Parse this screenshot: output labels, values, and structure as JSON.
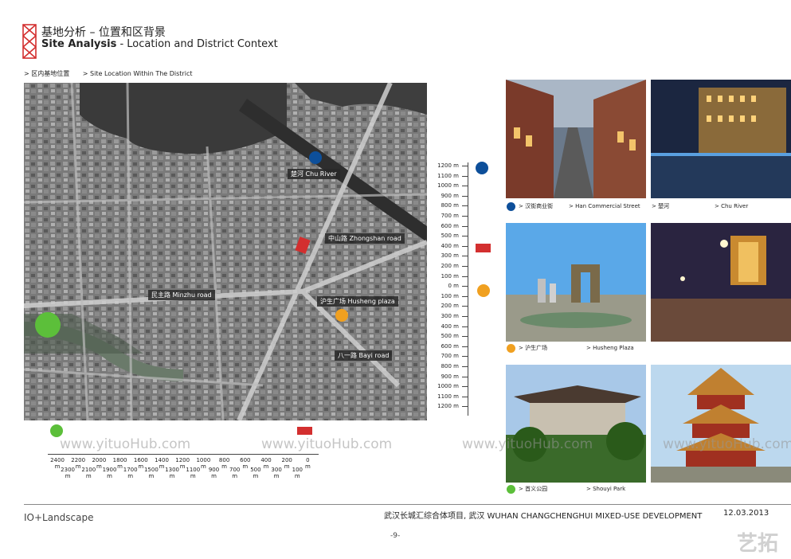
{
  "header": {
    "title_cn": "基地分析 – 位置和区背景",
    "title_en_bold": "Site Analysis",
    "title_en_rest": " - Location and District Context"
  },
  "subhead": {
    "cn": "> 区内基地位置",
    "en": "> Site Location Within The District"
  },
  "map": {
    "labels": {
      "chu_river": "楚河  Chu River",
      "zhongshan": "中山路  Zhongshan road",
      "minzhu": "民主路  Minzhu road",
      "husheng": "沪生广场  Husheng plaza",
      "bayi": "八一路  Bayi road"
    }
  },
  "scale_vertical": {
    "labels": [
      "1200 m",
      "1100 m",
      "1000 m",
      "900 m",
      "800 m",
      "700 m",
      "600 m",
      "500 m",
      "400 m",
      "300 m",
      "200 m",
      "100 m",
      "0 m",
      "100 m",
      "200 m",
      "300 m",
      "400 m",
      "500 m",
      "600 m",
      "700 m",
      "800 m",
      "900 m",
      "1000 m",
      "1100 m",
      "1200 m"
    ]
  },
  "scale_horizontal": {
    "labels": [
      "2400 m",
      "2300 m",
      "2200 m",
      "2100 m",
      "2000 m",
      "1900 m",
      "1800 m",
      "1700 m",
      "1600 m",
      "1500 m",
      "1400 m",
      "1300 m",
      "1200 m",
      "1100 m",
      "1000 m",
      "900 m",
      "800 m",
      "700 m",
      "600 m",
      "500 m",
      "400 m",
      "300 m",
      "200 m",
      "100 m",
      "0 m"
    ]
  },
  "photos": {
    "han_street": {
      "cn": "> 汉街商业街",
      "en": "> Han Commercial Street"
    },
    "chu_river": {
      "cn": "> 楚河",
      "en": "> Chu River"
    },
    "husheng": {
      "cn": "> 沪生广场",
      "en": "> Husheng Plaza"
    },
    "shouyi": {
      "cn": "> 首义公园",
      "en": "> Shouyi Park"
    }
  },
  "colors": {
    "blue": "#0d4f9a",
    "red": "#d32f2f",
    "orange": "#f0a020",
    "green": "#5cbf3a"
  },
  "footer": {
    "logo": "IO+Landscape",
    "project": "武汉长城汇综合体项目, 武汉   WUHAN CHANGCHENGHUI MIXED-USE DEVELOPMENT",
    "date": "12.03.2013",
    "page": "-9-"
  },
  "watermark": "www.yituoHub.com",
  "brand": "艺拓"
}
